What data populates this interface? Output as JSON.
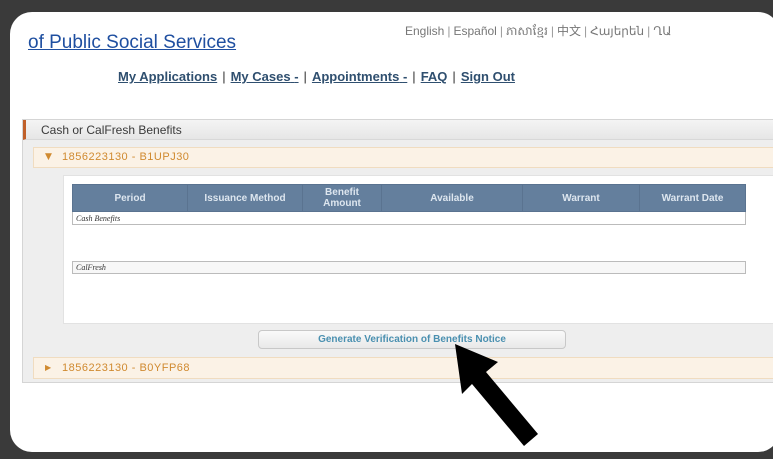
{
  "header": {
    "site_title": "of Public Social Services",
    "languages": [
      "English",
      "Español",
      "ភាសាខ្មែរ",
      "中文",
      "Հայերեն",
      "ՂԱ"
    ]
  },
  "nav": {
    "items": [
      "My Applications",
      "My Cases",
      "Appointments",
      "FAQ",
      "Sign Out"
    ],
    "caret": "-"
  },
  "panel": {
    "title": "Cash or CalFresh Benefits",
    "case_expanded": {
      "label": "1856223130 - B1UPJ30",
      "expander": "▼",
      "table": {
        "columns": [
          "Period",
          "Issuance Method",
          "Benefit Amount",
          "Available",
          "Warrant",
          "Warrant Date"
        ],
        "groups": [
          "Cash Benefits",
          "CalFresh"
        ]
      },
      "action_button": "Generate Verification of Benefits Notice"
    },
    "case_collapsed": {
      "label": "1856223130 - B0YFP68",
      "expander": "▶"
    }
  },
  "colors": {
    "title_link": "#1f4fa0",
    "nav_text": "#2f4f6f",
    "case_label": "#d08a30",
    "table_header_bg": "#647f9d",
    "button_text": "#4a90b0",
    "outer_bg": "#3a3a3a"
  },
  "annotation": {
    "icon": "black-arrow-pointer-icon"
  }
}
